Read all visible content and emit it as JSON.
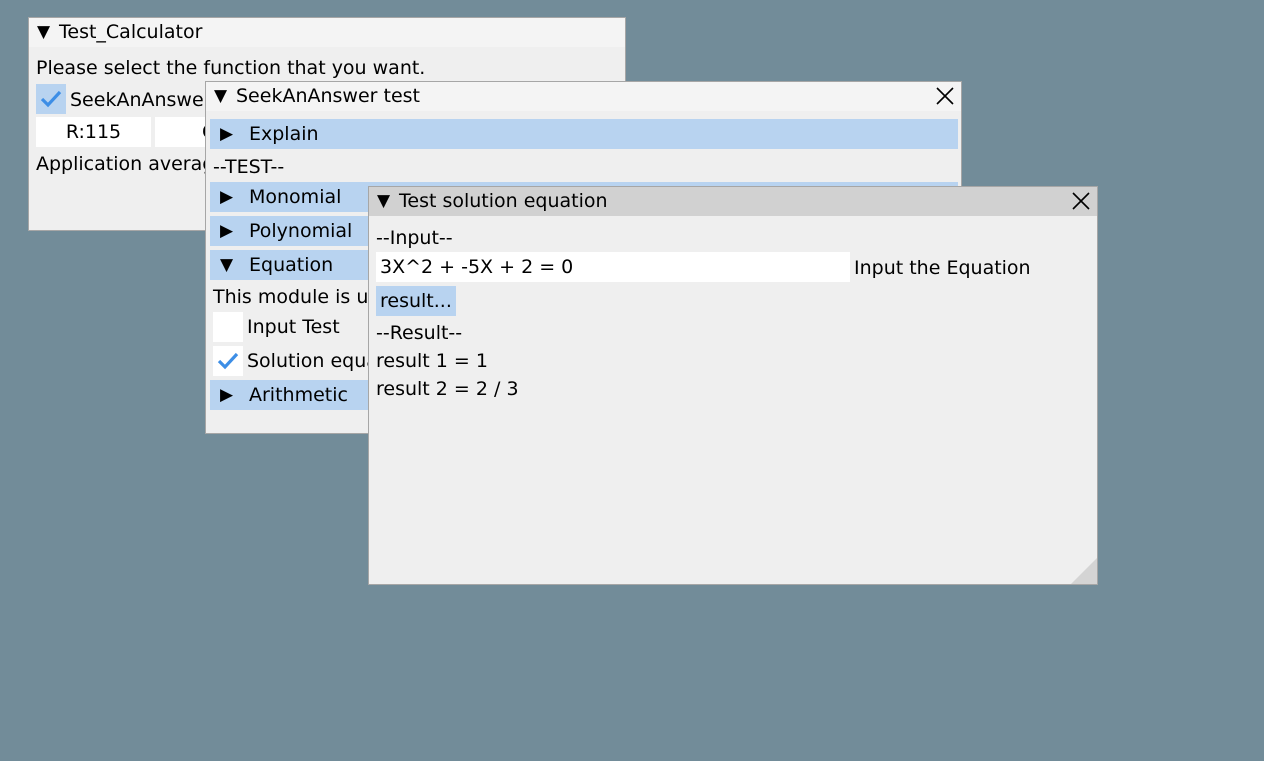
{
  "calc_window": {
    "title": "Test_Calculator",
    "prompt": "Please select the function that you want.",
    "checkbox_label": "SeekAnAnswer",
    "checkbox_checked": true,
    "r_field": "R:115",
    "g_field": "G:",
    "average_text": "Application averag"
  },
  "seek_window": {
    "title": "SeekAnAnswer test",
    "explain_label": "Explain",
    "test_heading": "--TEST--",
    "monomial_label": "Monomial",
    "polynomial_label": "Polynomial",
    "equation_label": "Equation",
    "module_text": "This module is us",
    "input_test_label": "Input Test",
    "input_test_checked": false,
    "solution_label": "Solution equa",
    "solution_checked": true,
    "arithmetic_label": "Arithmetic"
  },
  "solution_window": {
    "title": "Test solution equation",
    "input_heading": "--Input--",
    "equation_value": "3X^2 + -5X + 2 = 0",
    "equation_label": "Input the Equation",
    "result_button": "result...",
    "result_heading": "--Result--",
    "result1": "result 1 = 1",
    "result2": "result 2 = 2 / 3"
  },
  "colors": {
    "background": "#728c99",
    "window": "#efefef",
    "title_active": "#d1d1d1",
    "title_inactive": "#f4f4f4",
    "highlight": "#b8d3f0",
    "check": "#3d8ee6"
  }
}
